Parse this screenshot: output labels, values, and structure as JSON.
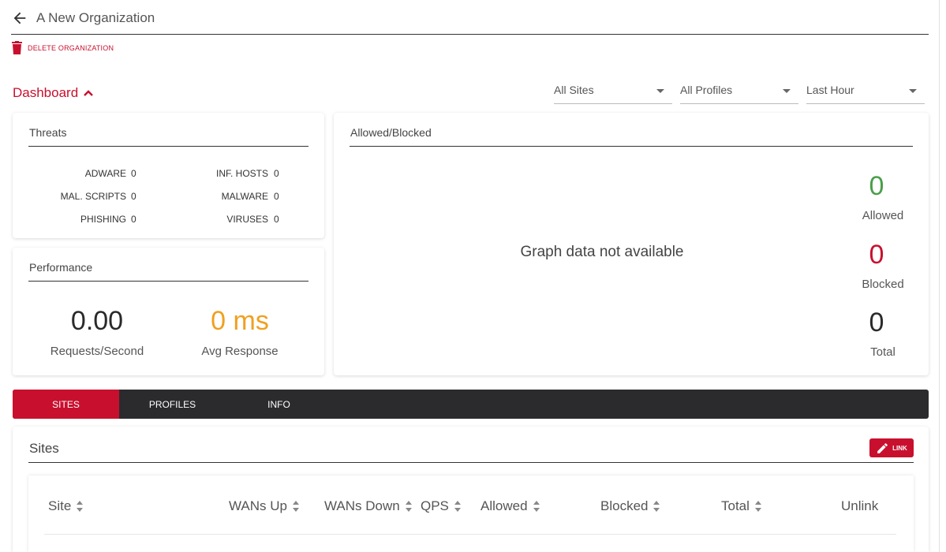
{
  "header": {
    "title": "A New Organization",
    "delete_label": "DELETE ORGANIZATION"
  },
  "dashboard": {
    "label": "Dashboard",
    "filters": {
      "sites": "All Sites",
      "profiles": "All Profiles",
      "time": "Last Hour"
    }
  },
  "threats": {
    "title": "Threats",
    "items": [
      {
        "label": "ADWARE",
        "value": "0"
      },
      {
        "label": "INF. HOSTS",
        "value": "0"
      },
      {
        "label": "MAL. SCRIPTS",
        "value": "0"
      },
      {
        "label": "MALWARE",
        "value": "0"
      },
      {
        "label": "PHISHING",
        "value": "0"
      },
      {
        "label": "VIRUSES",
        "value": "0"
      }
    ]
  },
  "performance": {
    "title": "Performance",
    "requests_value": "0.00",
    "requests_label": "Requests/Second",
    "response_value": "0 ms",
    "response_label": "Avg Response"
  },
  "allowed_blocked": {
    "title": "Allowed/Blocked",
    "no_data": "Graph data not available",
    "allowed_value": "0",
    "allowed_label": "Allowed",
    "blocked_value": "0",
    "blocked_label": "Blocked",
    "total_value": "0",
    "total_label": "Total"
  },
  "tabs": [
    {
      "label": "SITES",
      "active": true
    },
    {
      "label": "PROFILES",
      "active": false
    },
    {
      "label": "INFO",
      "active": false
    }
  ],
  "sites": {
    "title": "Sites",
    "link_label": "LINK",
    "columns": [
      "Site",
      "WANs Up",
      "WANs Down",
      "QPS",
      "Allowed",
      "Blocked",
      "Total",
      "Unlink"
    ]
  },
  "colors": {
    "accent": "#c8102e",
    "allowed": "#4a9e4a",
    "blocked": "#c8102e",
    "response": "#f0a020",
    "tabbar": "#2b2b2e"
  },
  "icons": {
    "back": "arrow-left-icon",
    "delete": "trash-icon",
    "collapse": "chevron-up-icon",
    "link": "pencil-icon",
    "sort": "sort-icon"
  }
}
